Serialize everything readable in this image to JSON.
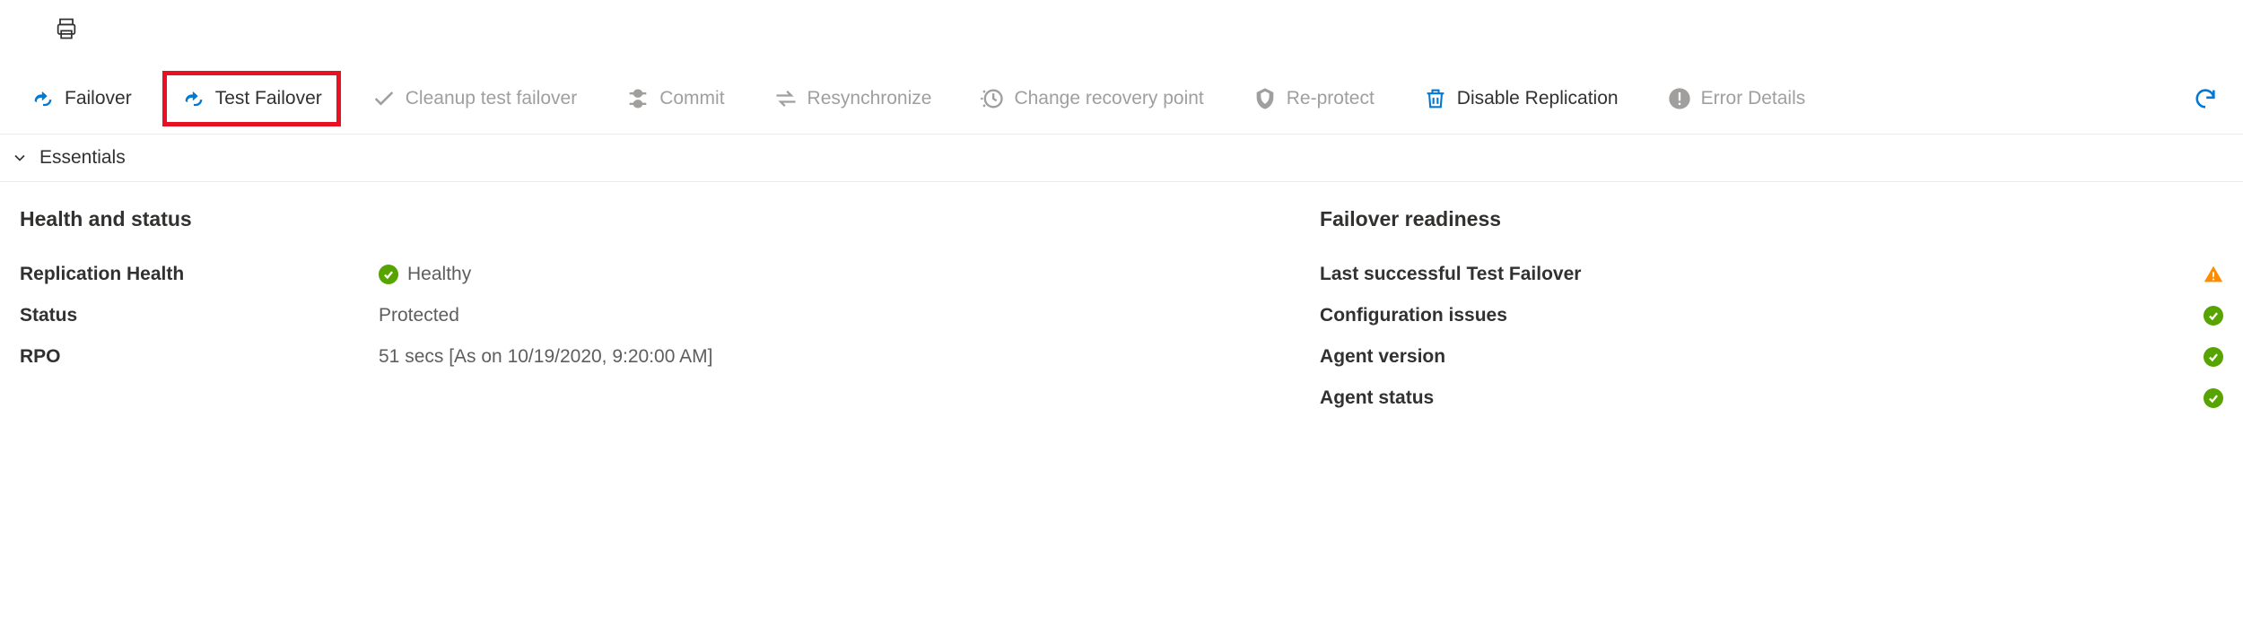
{
  "toolbar": {
    "failover": "Failover",
    "test_failover": "Test Failover",
    "cleanup": "Cleanup test failover",
    "commit": "Commit",
    "resync": "Resynchronize",
    "change_recovery": "Change recovery point",
    "reprotect": "Re-protect",
    "disable_replication": "Disable Replication",
    "error_details": "Error Details"
  },
  "essentials_label": "Essentials",
  "health": {
    "section_title": "Health and status",
    "replication_health_label": "Replication Health",
    "replication_health_value": "Healthy",
    "status_label": "Status",
    "status_value": "Protected",
    "rpo_label": "RPO",
    "rpo_value": "51 secs [As on 10/19/2020, 9:20:00 AM]"
  },
  "readiness": {
    "section_title": "Failover readiness",
    "last_test_failover": "Last successful Test Failover",
    "config_issues": "Configuration issues",
    "agent_version": "Agent version",
    "agent_status": "Agent status"
  }
}
